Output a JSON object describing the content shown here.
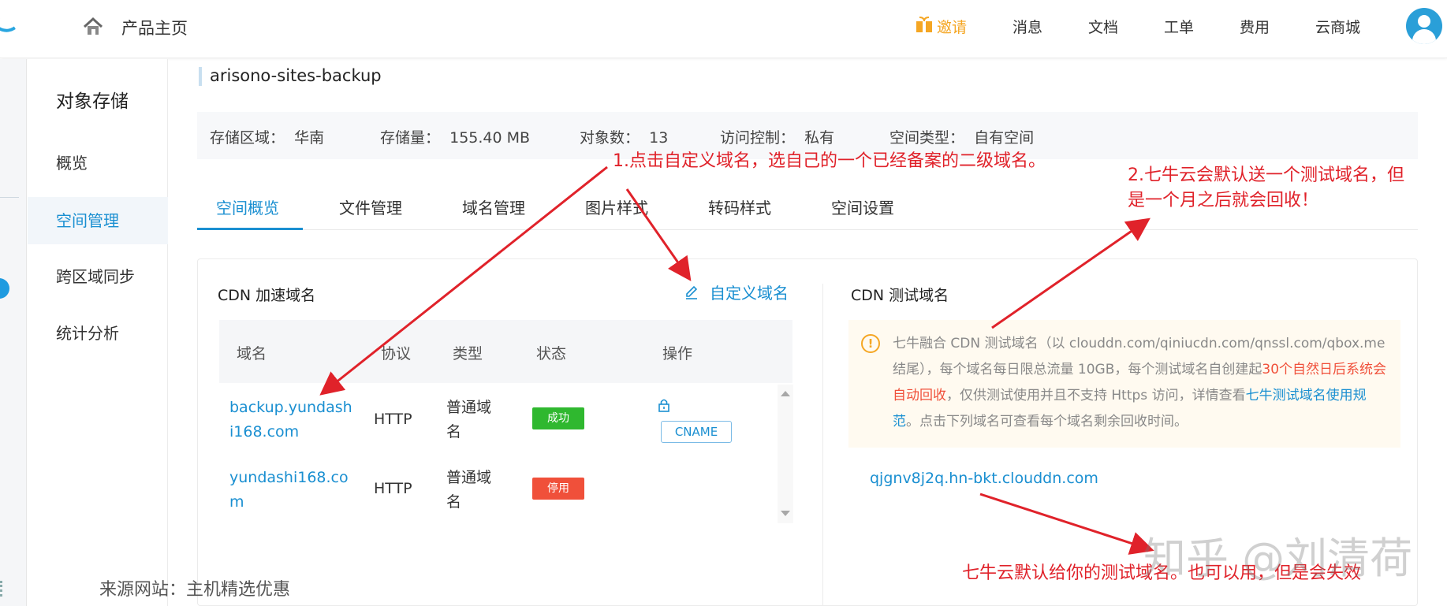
{
  "topbar": {
    "product_home": "产品主页",
    "nav": {
      "invite": "邀请",
      "messages": "消息",
      "docs": "文档",
      "tickets": "工单",
      "billing": "费用",
      "marketplace": "云商城"
    },
    "accent_color": "#1a8fd1",
    "invite_color": "#f5a623"
  },
  "sidebar": {
    "title": "对象存储",
    "items": [
      {
        "label": "概览"
      },
      {
        "label": "空间管理"
      },
      {
        "label": "跨区域同步"
      },
      {
        "label": "统计分析"
      }
    ],
    "active": "空间管理"
  },
  "bucket": {
    "name": "arisono-sites-backup",
    "info": [
      {
        "label": "存储区域：",
        "value": "华南"
      },
      {
        "label": "存储量：",
        "value": "155.40 MB"
      },
      {
        "label": "对象数：",
        "value": "13"
      },
      {
        "label": "访问控制：",
        "value": "私有"
      },
      {
        "label": "空间类型：",
        "value": "自有空间"
      }
    ]
  },
  "tabs": [
    "空间概览",
    "文件管理",
    "域名管理",
    "图片样式",
    "转码样式",
    "空间设置"
  ],
  "cdn": {
    "title": "CDN 加速域名",
    "custom_domain": "自定义域名",
    "columns": [
      "域名",
      "协议",
      "类型",
      "状态",
      "操作"
    ],
    "rows": [
      {
        "domain_l1": "backup.yundash",
        "domain_l2": "i168.com",
        "protocol": "HTTP",
        "type_l1": "普通域",
        "type_l2": "名",
        "status": "成功",
        "action": "CNAME"
      },
      {
        "domain_l1": "yundashi168.co",
        "domain_l2": "m",
        "protocol": "HTTP",
        "type_l1": "普通域",
        "type_l2": "名",
        "status": "停用"
      }
    ]
  },
  "test": {
    "title": "CDN 测试域名",
    "notice": {
      "part1": "七牛融合 CDN 测试域名（以 clouddn.com/qiniucdn.com/qnssl.com/qbox.me 结尾），每个域名每日限总流量 10GB，每个测试域名自创建起",
      "red": "30个自然日后系统会自动回收",
      "part2": "，仅供测试使用并且不支持 Https 访问，详情查看",
      "link": "七牛测试域名使用规范",
      "part3": "。点击下列域名可查看每个域名剩余回收时间。"
    },
    "domain": "qjgnv8j2q.hn-bkt.clouddn.com"
  },
  "annotations": {
    "a1": "1.点击自定义域名，选自己的一个已经备案的二级域名。",
    "a2_l1": "2.七牛云会默认送一个测试域名，但",
    "a2_l2": "是一个月之后就会回收！",
    "a3": "七牛云默认给你的测试域名。也可以用，但是会失效",
    "color": "#e0222a"
  },
  "watermark": "知乎 @刘清荷",
  "source": "来源网站：主机精选优惠"
}
